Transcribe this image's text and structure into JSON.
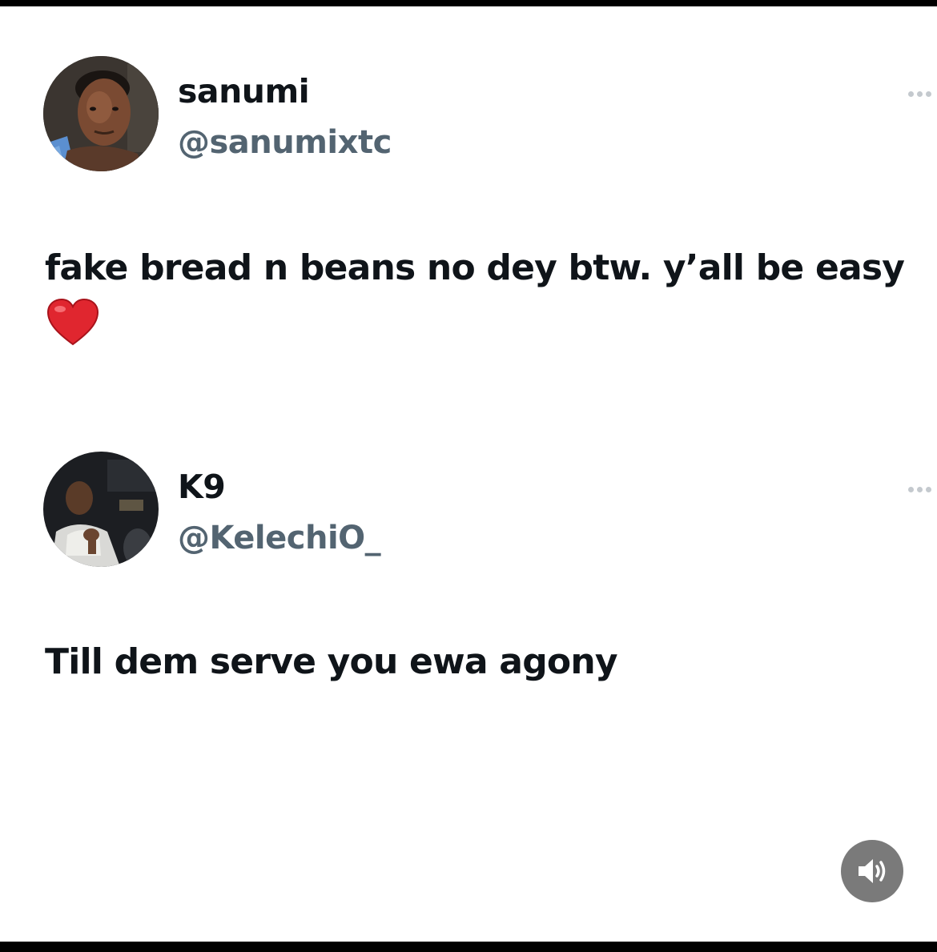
{
  "tweets": [
    {
      "display_name": "sanumi",
      "handle": "@sanumixtc",
      "avatar_icon": "user-avatar-photo",
      "more_icon": "ellipsis-icon",
      "text": "fake bread n beans no dey btw. y’all be easy",
      "emoji": "red-heart"
    },
    {
      "display_name": "K9",
      "handle": "@KelechiO_",
      "avatar_icon": "user-avatar-photo",
      "more_icon": "ellipsis-icon",
      "text": "Till dem serve you ewa agony"
    }
  ],
  "controls": {
    "sound_icon": "speaker-volume-icon"
  },
  "colors": {
    "name_text": "#0f1419",
    "handle_text": "#536471",
    "heart": "#e0262f",
    "sound_button_bg": "#7a7a7a"
  }
}
